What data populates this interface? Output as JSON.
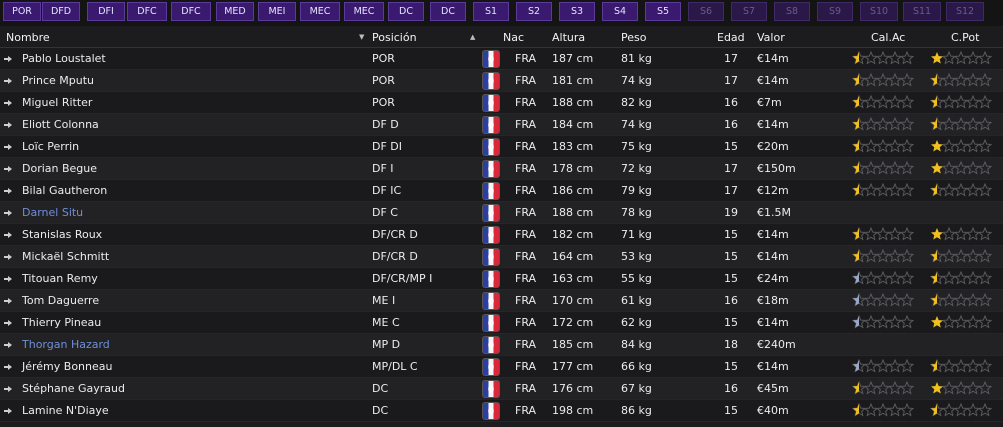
{
  "tabs": [
    {
      "label": "POR",
      "enabled": true
    },
    {
      "label": "DFD",
      "enabled": true
    },
    {
      "label": "DFI",
      "enabled": true
    },
    {
      "label": "DFC",
      "enabled": true
    },
    {
      "label": "DFC",
      "enabled": true
    },
    {
      "label": "MED",
      "enabled": true
    },
    {
      "label": "MEI",
      "enabled": true
    },
    {
      "label": "MEC",
      "enabled": true
    },
    {
      "label": "MEC",
      "enabled": true
    },
    {
      "label": "DC",
      "enabled": true
    },
    {
      "label": "DC",
      "enabled": true
    },
    {
      "label": "S1",
      "enabled": true
    },
    {
      "label": "S2",
      "enabled": true
    },
    {
      "label": "S3",
      "enabled": true
    },
    {
      "label": "S4",
      "enabled": true
    },
    {
      "label": "S5",
      "enabled": true
    },
    {
      "label": "S6",
      "enabled": false
    },
    {
      "label": "S7",
      "enabled": false
    },
    {
      "label": "S8",
      "enabled": false
    },
    {
      "label": "S9",
      "enabled": false
    },
    {
      "label": "S10",
      "enabled": false
    },
    {
      "label": "S11",
      "enabled": false
    },
    {
      "label": "S12",
      "enabled": false
    }
  ],
  "columns": {
    "nombre": "Nombre",
    "posicion": "Posición",
    "nac": "Nac",
    "altura": "Altura",
    "peso": "Peso",
    "edad": "Edad",
    "valor": "Valor",
    "cal_ac": "Cal.Ac",
    "c_pot": "C.Pot"
  },
  "colors": {
    "loan_name": "#6f8fd8",
    "star_gold": "#f0c020",
    "star_empty": "#5a5a5e",
    "star_silver": "#9aa8c8"
  },
  "players": [
    {
      "name": "Pablo Loustalet",
      "pos": "POR",
      "nac": "FRA",
      "height": "187 cm",
      "weight": "81 kg",
      "age": "17",
      "value": "€14m",
      "loan": false,
      "cur": 0.5,
      "pot": 1.0,
      "cur_tier": "gold",
      "pot_tier": "gold"
    },
    {
      "name": "Prince Mputu",
      "pos": "POR",
      "nac": "FRA",
      "height": "181 cm",
      "weight": "74 kg",
      "age": "17",
      "value": "€14m",
      "loan": false,
      "cur": 0.5,
      "pot": 0.5,
      "cur_tier": "gold",
      "pot_tier": "gold"
    },
    {
      "name": "Miguel Ritter",
      "pos": "POR",
      "nac": "FRA",
      "height": "188 cm",
      "weight": "82 kg",
      "age": "16",
      "value": "€7m",
      "loan": false,
      "cur": 0.5,
      "pot": 0.5,
      "cur_tier": "gold",
      "pot_tier": "gold"
    },
    {
      "name": "Eliott Colonna",
      "pos": "DF D",
      "nac": "FRA",
      "height": "184 cm",
      "weight": "74 kg",
      "age": "16",
      "value": "€14m",
      "loan": false,
      "cur": 0.5,
      "pot": 0.5,
      "cur_tier": "gold",
      "pot_tier": "gold"
    },
    {
      "name": "Loïc Perrin",
      "pos": "DF DI",
      "nac": "FRA",
      "height": "183 cm",
      "weight": "75 kg",
      "age": "15",
      "value": "€20m",
      "loan": false,
      "cur": 0.5,
      "pot": 1.0,
      "cur_tier": "gold",
      "pot_tier": "gold"
    },
    {
      "name": "Dorian Begue",
      "pos": "DF I",
      "nac": "FRA",
      "height": "178 cm",
      "weight": "72 kg",
      "age": "17",
      "value": "€150m",
      "loan": false,
      "cur": 0.5,
      "pot": 1.0,
      "cur_tier": "gold",
      "pot_tier": "gold"
    },
    {
      "name": "Bilal Gautheron",
      "pos": "DF IC",
      "nac": "FRA",
      "height": "186 cm",
      "weight": "79 kg",
      "age": "17",
      "value": "€12m",
      "loan": false,
      "cur": 0.5,
      "pot": 0.5,
      "cur_tier": "gold",
      "pot_tier": "gold"
    },
    {
      "name": "Darnel Situ",
      "pos": "DF C",
      "nac": "FRA",
      "height": "188 cm",
      "weight": "78 kg",
      "age": "19",
      "value": "€1.5M",
      "loan": true,
      "cur": null,
      "pot": null,
      "cur_tier": "none",
      "pot_tier": "none"
    },
    {
      "name": "Stanislas Roux",
      "pos": "DF/CR D",
      "nac": "FRA",
      "height": "182 cm",
      "weight": "71 kg",
      "age": "15",
      "value": "€14m",
      "loan": false,
      "cur": 0.5,
      "pot": 1.0,
      "cur_tier": "gold",
      "pot_tier": "gold"
    },
    {
      "name": "Mickaël Schmitt",
      "pos": "DF/CR D",
      "nac": "FRA",
      "height": "164 cm",
      "weight": "53 kg",
      "age": "15",
      "value": "€14m",
      "loan": false,
      "cur": 0.5,
      "pot": 0.5,
      "cur_tier": "gold",
      "pot_tier": "gold"
    },
    {
      "name": "Titouan Remy",
      "pos": "DF/CR/MP I",
      "nac": "FRA",
      "height": "163 cm",
      "weight": "55 kg",
      "age": "15",
      "value": "€24m",
      "loan": false,
      "cur": 0.5,
      "pot": 0.5,
      "cur_tier": "silver",
      "pot_tier": "gold"
    },
    {
      "name": "Tom Daguerre",
      "pos": "ME I",
      "nac": "FRA",
      "height": "170 cm",
      "weight": "61 kg",
      "age": "16",
      "value": "€18m",
      "loan": false,
      "cur": 0.5,
      "pot": 0.5,
      "cur_tier": "silver",
      "pot_tier": "gold"
    },
    {
      "name": "Thierry Pineau",
      "pos": "ME C",
      "nac": "FRA",
      "height": "172 cm",
      "weight": "62 kg",
      "age": "15",
      "value": "€14m",
      "loan": false,
      "cur": 0.5,
      "pot": 1.0,
      "cur_tier": "silver",
      "pot_tier": "gold"
    },
    {
      "name": "Thorgan Hazard",
      "pos": "MP D",
      "nac": "FRA",
      "height": "185 cm",
      "weight": "84 kg",
      "age": "18",
      "value": "€240m",
      "loan": true,
      "cur": null,
      "pot": null,
      "cur_tier": "none",
      "pot_tier": "none"
    },
    {
      "name": "Jérémy Bonneau",
      "pos": "MP/DL C",
      "nac": "FRA",
      "height": "177 cm",
      "weight": "66 kg",
      "age": "15",
      "value": "€14m",
      "loan": false,
      "cur": 0.5,
      "pot": 0.5,
      "cur_tier": "silver",
      "pot_tier": "gold"
    },
    {
      "name": "Stéphane Gayraud",
      "pos": "DC",
      "nac": "FRA",
      "height": "176 cm",
      "weight": "67 kg",
      "age": "16",
      "value": "€45m",
      "loan": false,
      "cur": 0.5,
      "pot": 1.0,
      "cur_tier": "gold",
      "pot_tier": "gold"
    },
    {
      "name": "Lamine N'Diaye",
      "pos": "DC",
      "nac": "FRA",
      "height": "198 cm",
      "weight": "86 kg",
      "age": "15",
      "value": "€40m",
      "loan": false,
      "cur": 0.5,
      "pot": 0.5,
      "cur_tier": "gold",
      "pot_tier": "gold"
    }
  ]
}
